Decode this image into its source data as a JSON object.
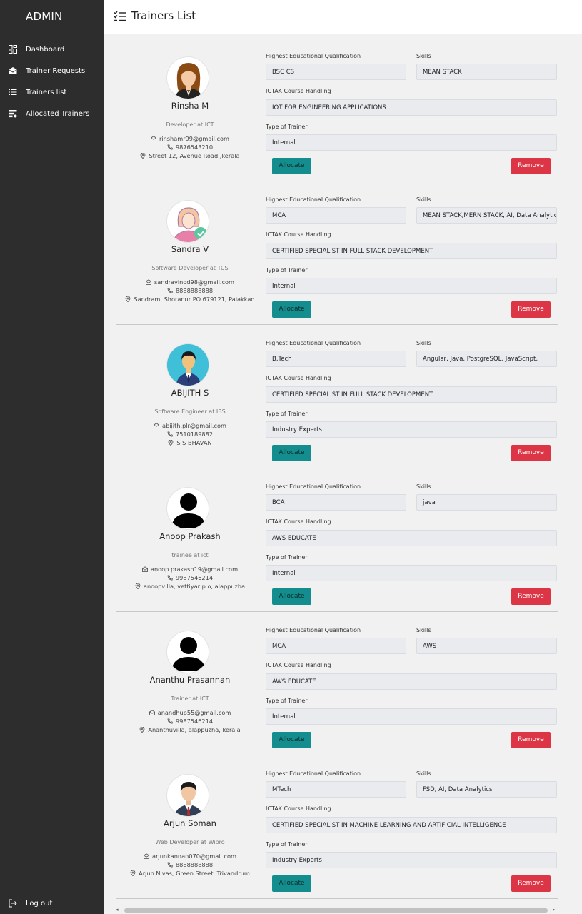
{
  "sidebar": {
    "brand": "ADMIN",
    "items": [
      {
        "label": "Dashboard",
        "icon": "dashboard-icon"
      },
      {
        "label": "Trainer Requests",
        "icon": "mail-open-icon"
      },
      {
        "label": "Trainers list",
        "icon": "list-icon"
      },
      {
        "label": "Allocated Trainers",
        "icon": "allocated-icon"
      }
    ],
    "logout": "Log out"
  },
  "header": {
    "title": "Trainers List"
  },
  "labels": {
    "qualification": "Highest Educational Qualification",
    "skills": "Skills",
    "course": "ICTAK Course Handling",
    "type": "Type of Trainer",
    "allocate": "Allocate",
    "remove": "Remove"
  },
  "trainers": [
    {
      "name": "Rinsha M",
      "role": "Developer at ICT",
      "email": "rinshamr99@gmail.com",
      "phone": "9876543210",
      "address": "Street 12, Avenue Road ,kerala",
      "qualification": "BSC CS",
      "skills": "MEAN STACK",
      "course": "IOT FOR ENGINEERING APPLICATIONS",
      "type": "Internal",
      "avatar": "female-avatar"
    },
    {
      "name": "Sandra V",
      "role": "Software Developer at TCS",
      "email": "sandravinod98@gmail.com",
      "phone": "8888888888",
      "address": "Sandram, Shoranur PO 679121, Palakkad",
      "qualification": "MCA",
      "skills": "MEAN STACK,MERN STACK, AI, Data Analytics",
      "course": "CERTIFIED SPECIALIST IN FULL STACK DEVELOPMENT",
      "type": "Internal",
      "avatar": "verified-female-avatar"
    },
    {
      "name": "ABIJITH S",
      "role": "Software Engineer at IBS",
      "email": "abijith.plr@gmail.com",
      "phone": "7510189882",
      "address": "S S BHAVAN",
      "qualification": "B.Tech",
      "skills": "Angular, Java, PostgreSQL, JavaScript,",
      "course": "CERTIFIED SPECIALIST IN FULL STACK DEVELOPMENT",
      "type": "Industry Experts",
      "avatar": "male-business-avatar"
    },
    {
      "name": "Anoop Prakash",
      "role": "trainee at ict",
      "email": "anoop.prakash19@gmail.com",
      "phone": "9987546214",
      "address": "anoopvilla, vettiyar p.o, alappuzha",
      "qualification": "BCA",
      "skills": "java",
      "course": "AWS EDUCATE",
      "type": "Internal",
      "avatar": "default-user-avatar"
    },
    {
      "name": "Ananthu Prasannan",
      "role": "Trainer at ICT",
      "email": "anandhup55@gmail.com",
      "phone": "9987546214",
      "address": "Ananthuvilla, alappuzha, kerala",
      "qualification": "MCA",
      "skills": "AWS",
      "course": "AWS EDUCATE",
      "type": "Internal",
      "avatar": "default-user-avatar"
    },
    {
      "name": "Arjun Soman",
      "role": "Web Developer at Wipro",
      "email": "arjunkannan070@gmail.com",
      "phone": "8888888888",
      "address": "Arjun Nivas, Green Street, Trivandrum",
      "qualification": "MTech",
      "skills": "FSD, AI, Data Analytics",
      "course": "CERTIFIED SPECIALIST IN MACHINE LEARNING AND ARTIFICIAL INTELLIGENCE",
      "type": "Industry Experts",
      "avatar": "male-suit-avatar"
    }
  ],
  "colors": {
    "sidebar": "#2d2d2d",
    "allocate": "#138d8d",
    "remove": "#dc3545"
  }
}
